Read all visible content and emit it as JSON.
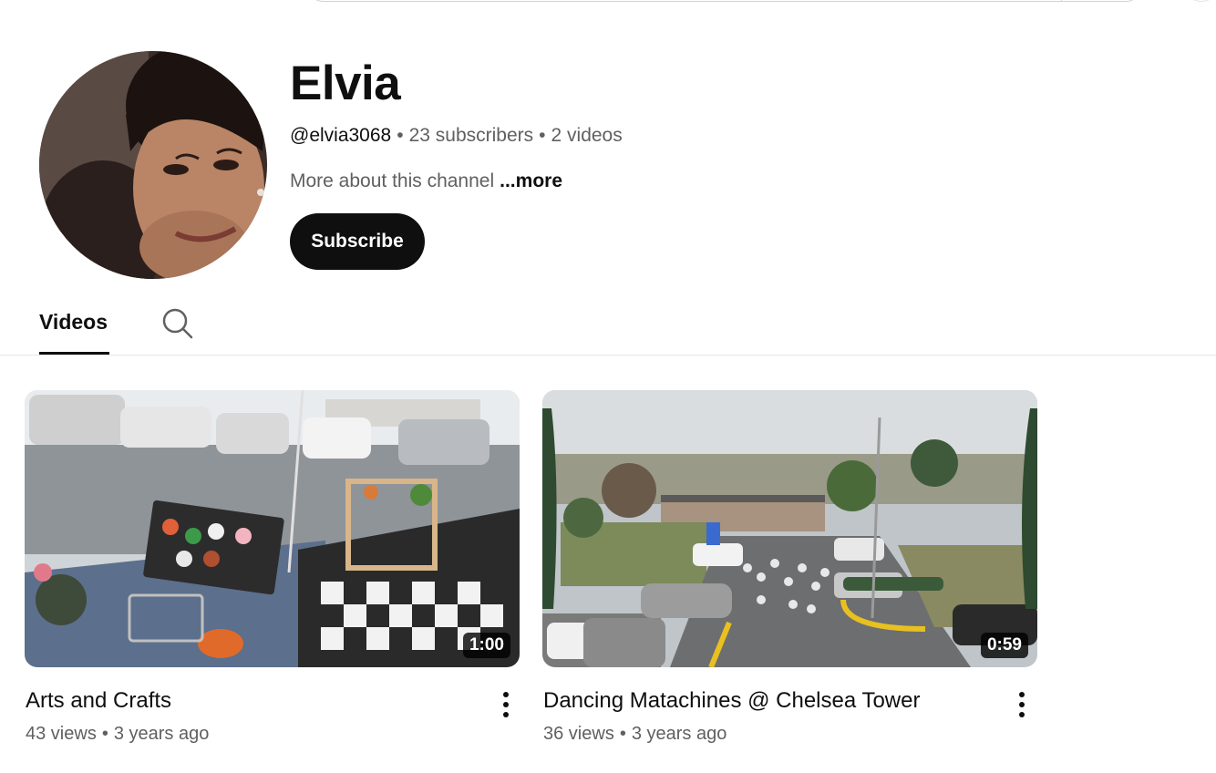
{
  "channel": {
    "name": "Elvia",
    "handle": "@elvia3068",
    "subscribers": "23 subscribers",
    "videos_count": "2 videos",
    "separator": "•",
    "about": "More about this channel",
    "more_label": "...more",
    "subscribe_label": "Subscribe"
  },
  "tabs": {
    "videos_label": "Videos"
  },
  "videos": [
    {
      "title": "Arts and Crafts",
      "duration": "1:00",
      "views": "43 views",
      "age": "3 years ago"
    },
    {
      "title": "Dancing Matachines @ Chelsea Tower",
      "duration": "0:59",
      "views": "36 views",
      "age": "3 years ago"
    }
  ],
  "icons": {
    "tab_search": "search-icon",
    "video_menu": "more-vert-icon"
  },
  "colors": {
    "text_primary": "#0f0f0f",
    "text_secondary": "#606060",
    "subscribe_bg": "#0f0f0f",
    "divider": "#e5e5e5"
  }
}
